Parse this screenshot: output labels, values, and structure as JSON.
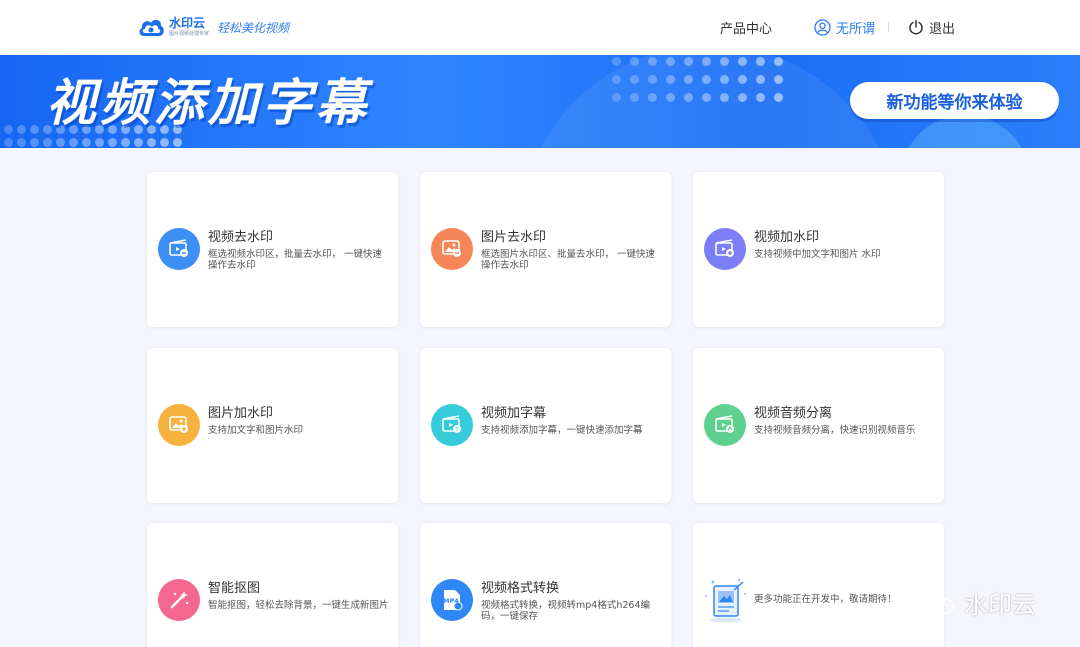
{
  "header": {
    "logo_name": "水印云",
    "logo_sub": "图片视频处理专家",
    "slogan": "轻松美化视频",
    "nav_product": "产品中心",
    "nav_user": "无所谓",
    "nav_logout": "退出"
  },
  "banner": {
    "title": "视频添加字幕",
    "button": "新功能等你来体验"
  },
  "cards": [
    {
      "title": "视频去水印",
      "desc": "框选视频水印区，批量去水印， 一键快速操作去水印",
      "icon": "video-remove-watermark-icon",
      "color": "#3d8ef5"
    },
    {
      "title": "图片去水印",
      "desc": "框选图片水印区、批量去水印， 一键快速操作去水印",
      "icon": "image-remove-watermark-icon",
      "color": "#f5865a"
    },
    {
      "title": "视频加水印",
      "desc": "支持视频中加文字和图片 水印",
      "icon": "video-add-watermark-icon",
      "color": "#7b7ef4"
    },
    {
      "title": "图片加水印",
      "desc": "支持加文字和图片水印",
      "icon": "image-add-watermark-icon",
      "color": "#f6b13f"
    },
    {
      "title": "视频加字幕",
      "desc": "支持视频添加字幕，一键快速添加字幕",
      "icon": "video-subtitle-icon",
      "color": "#35cbd9"
    },
    {
      "title": "视频音频分离",
      "desc": "支持视频音频分离，快速识别视频音乐",
      "icon": "audio-separate-icon",
      "color": "#5fd18f"
    },
    {
      "title": "智能抠图",
      "desc": "智能抠图，轻松去除背景，一键生成新图片",
      "icon": "magic-wand-icon",
      "color": "#f4678f"
    },
    {
      "title": "视频格式转换",
      "desc": "视频格式转换，视频转mp4格式h264编码，一键保存",
      "icon": "mp4-convert-icon",
      "color": "#2f86f5",
      "badge": "MP4"
    },
    {
      "title": "",
      "desc": "更多功能正在开发中，敬请期待！",
      "icon": "coming-soon-illustration-icon",
      "color": "#2f86f5"
    }
  ],
  "watermark": "水印云",
  "colors": {
    "brand": "#2d7cf0",
    "banner": "#1f74f6",
    "bg": "#f4f6fb"
  }
}
